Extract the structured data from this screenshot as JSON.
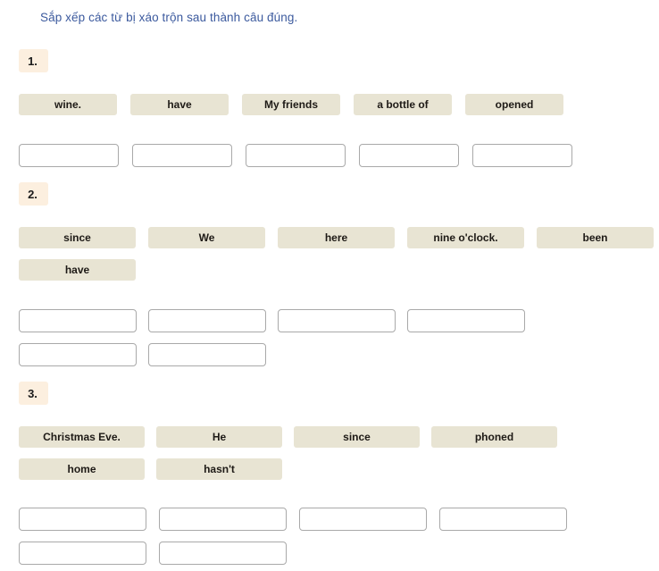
{
  "instruction": "Sắp xếp các từ bị xáo trộn sau thành câu đúng.",
  "colors": {
    "instruction_text": "#3c5a9e",
    "badge_background": "#fcefdf",
    "chip_background": "#e8e4d3",
    "chip_text": "#1e1a16",
    "slot_border": "#a9a9a9",
    "page_background": "#ffffff"
  },
  "questions": [
    {
      "number": "1.",
      "token_rows": [
        [
          "wine.",
          "have",
          "My friends",
          "a bottle of",
          "opened"
        ]
      ],
      "slot_rows": [
        [
          "",
          "",
          "",
          "",
          ""
        ]
      ]
    },
    {
      "number": "2.",
      "token_rows": [
        [
          "since",
          "We",
          "here",
          "nine o'clock.",
          "been"
        ],
        [
          "have"
        ]
      ],
      "slot_rows": [
        [
          "",
          "",
          "",
          ""
        ],
        [
          "",
          ""
        ]
      ]
    },
    {
      "number": "3.",
      "token_rows": [
        [
          "Christmas Eve.",
          "He",
          "since",
          "phoned"
        ],
        [
          "home",
          "hasn't"
        ]
      ],
      "slot_rows": [
        [
          "",
          "",
          "",
          ""
        ],
        [
          "",
          ""
        ]
      ]
    }
  ]
}
